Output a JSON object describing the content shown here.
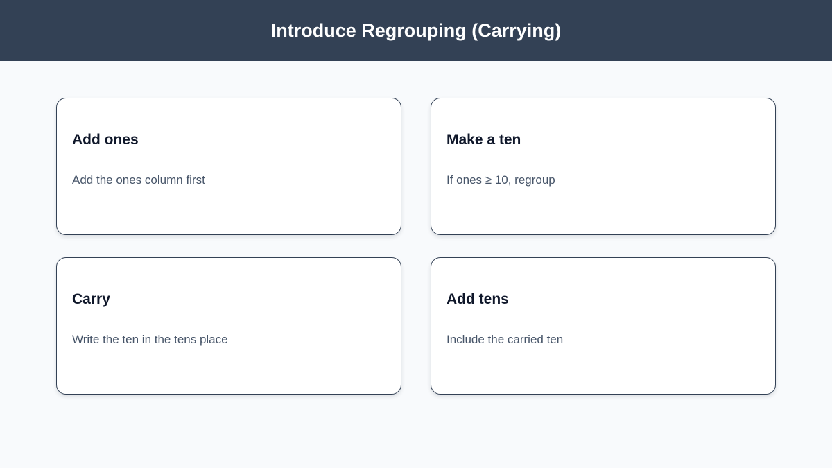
{
  "header": {
    "title": "Introduce Regrouping (Carrying)"
  },
  "cards": [
    {
      "title": "Add ones",
      "text": "Add the ones column first"
    },
    {
      "title": "Make a ten",
      "text": "If ones ≥ 10, regroup"
    },
    {
      "title": "Carry",
      "text": "Write the ten in the tens place"
    },
    {
      "title": "Add tens",
      "text": "Include the carried ten"
    }
  ],
  "colors": {
    "header_bg": "#334155",
    "page_bg": "#f8fafc",
    "card_border": "#334155",
    "title_text": "#0f172a",
    "body_text": "#475569"
  }
}
